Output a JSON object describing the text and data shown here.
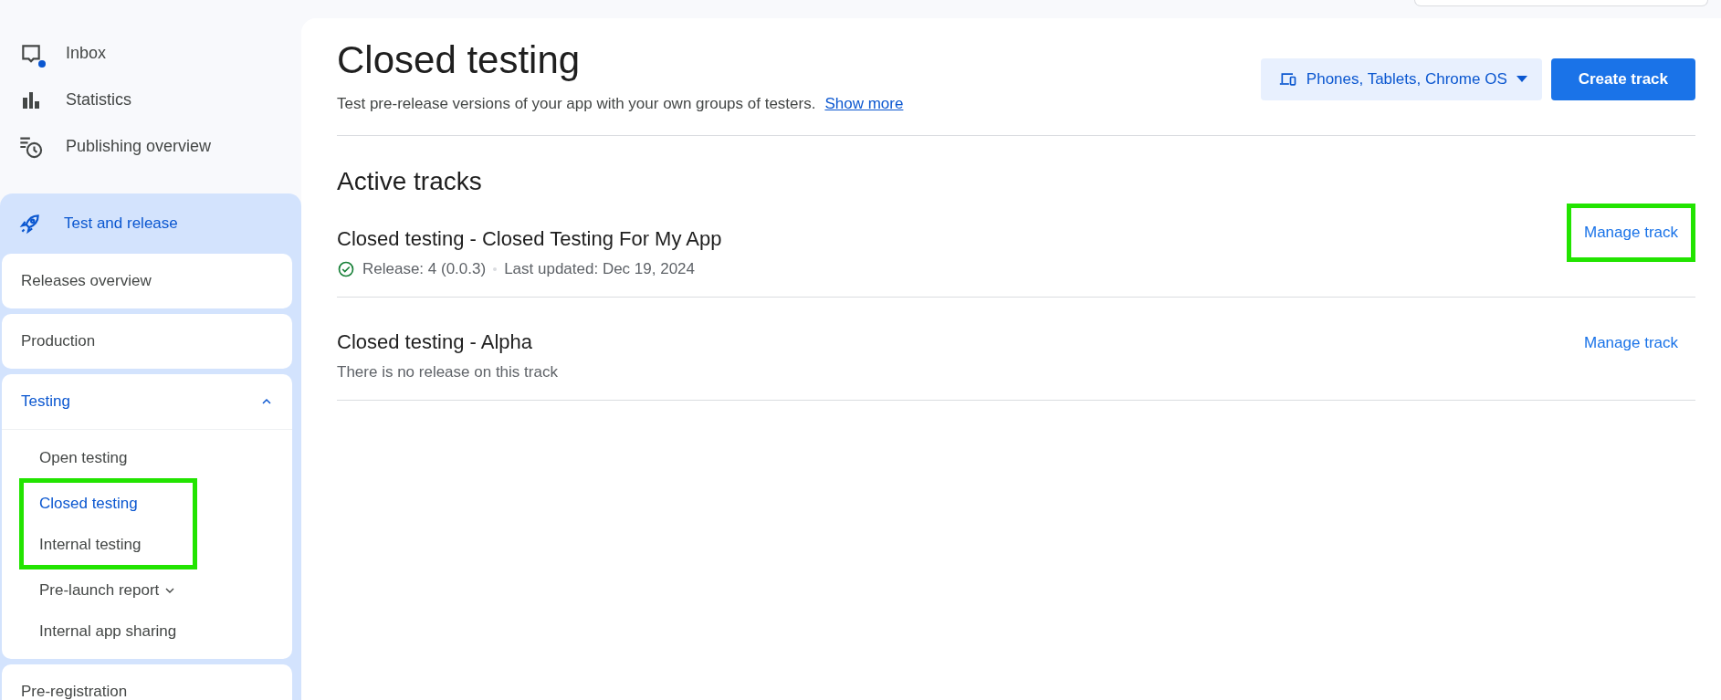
{
  "sidebar": {
    "items": [
      {
        "label": "Inbox",
        "badge": true
      },
      {
        "label": "Statistics",
        "badge": false
      },
      {
        "label": "Publishing overview",
        "badge": false
      }
    ],
    "section": {
      "label": "Test and release",
      "expanded": true,
      "groups": [
        {
          "label": "Releases overview",
          "expanded": false,
          "selected": false
        },
        {
          "label": "Production",
          "expanded": false,
          "selected": false
        },
        {
          "label": "Testing",
          "expanded": true,
          "selected": true,
          "children": [
            {
              "label": "Open testing",
              "selected": false,
              "highlighted": false,
              "has_menu": false
            },
            {
              "label": "Closed testing",
              "selected": true,
              "highlighted": true,
              "has_menu": false
            },
            {
              "label": "Internal testing",
              "selected": false,
              "highlighted": true,
              "has_menu": false
            },
            {
              "label": "Pre-launch report",
              "selected": false,
              "highlighted": false,
              "has_menu": true
            },
            {
              "label": "Internal app sharing",
              "selected": false,
              "highlighted": false,
              "has_menu": false
            }
          ]
        },
        {
          "label": "Pre-registration",
          "expanded": false,
          "selected": false
        }
      ]
    }
  },
  "header": {
    "title": "Closed testing",
    "description": "Test pre-release versions of your app with your own groups of testers.",
    "link": "Show more",
    "device_filter": "Phones, Tablets, Chrome OS",
    "primary_button": "Create track"
  },
  "active_tracks": {
    "heading": "Active tracks",
    "tracks": [
      {
        "name": "Closed testing - Closed Testing For My App",
        "released": true,
        "release": "Release: 4 (0.0.3)",
        "updated": "Last updated: Dec 19, 2024",
        "action": "Manage track",
        "highlighted": true
      },
      {
        "name": "Closed testing - Alpha",
        "released": false,
        "release": "There is no release on this track",
        "action": "Manage track",
        "highlighted": false
      }
    ]
  }
}
